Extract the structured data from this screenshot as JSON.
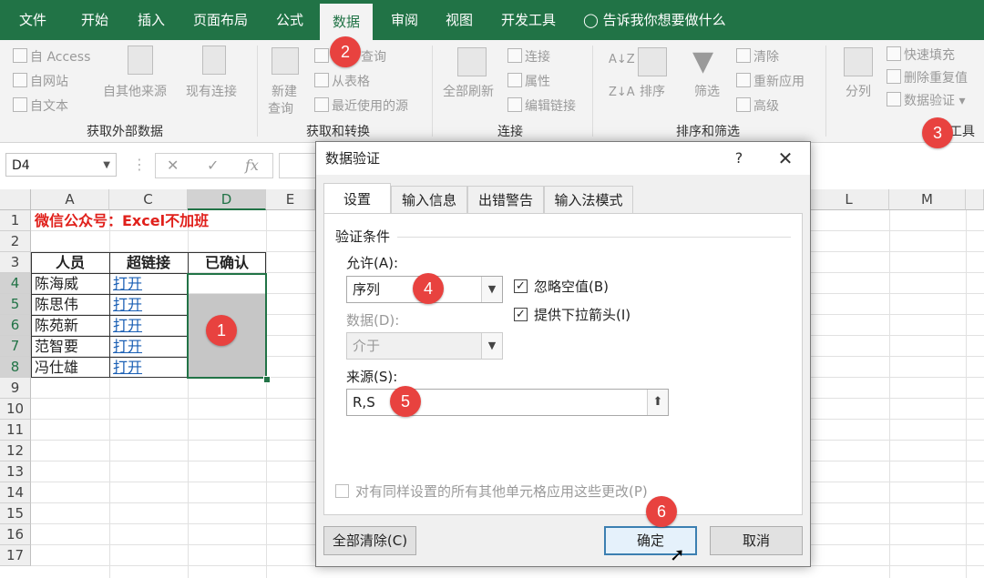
{
  "ribbon_tabs": [
    {
      "label": "文件"
    },
    {
      "label": "开始"
    },
    {
      "label": "插入"
    },
    {
      "label": "页面布局"
    },
    {
      "label": "公式"
    },
    {
      "label": "数据",
      "active": true
    },
    {
      "label": "审阅"
    },
    {
      "label": "视图"
    },
    {
      "label": "开发工具"
    }
  ],
  "tell_me": "告诉我你想要做什么",
  "ribbon": {
    "get_external": {
      "access": "自 Access",
      "web": "自网站",
      "text": "自文本",
      "other_sources": "自其他来源",
      "existing_connections": "现有连接",
      "group": "获取外部数据"
    },
    "get_transform": {
      "new_query": "新建",
      "new_query_sub": "查询",
      "show_queries": "查询",
      "from_table": "从表格",
      "recent_sources": "最近使用的源",
      "group": "获取和转换"
    },
    "connections": {
      "refresh_all": "全部刷新",
      "connections": "连接",
      "properties": "属性",
      "edit_links": "编辑链接",
      "group": "连接"
    },
    "sort_filter": {
      "sort": "排序",
      "filter": "筛选",
      "clear": "清除",
      "reapply": "重新应用",
      "advanced": "高级",
      "group": "排序和筛选"
    },
    "data_tools": {
      "text_to_columns": "分列",
      "flash_fill": "快速填充",
      "remove_duplicates": "删除重复值",
      "data_validation": "数据验证",
      "group_partial": "工具"
    }
  },
  "formula_bar": {
    "name_box": "D4",
    "fx": "fx"
  },
  "sheet": {
    "columns": [
      "A",
      "C",
      "D",
      "E",
      "L",
      "M"
    ],
    "rows": [
      "1",
      "2",
      "3",
      "4",
      "5",
      "6",
      "7",
      "8",
      "9",
      "10",
      "11",
      "12",
      "13",
      "14",
      "15",
      "16",
      "17"
    ],
    "banner": "微信公众号：Excel不加班",
    "headers": [
      "人员",
      "超链接",
      "已确认"
    ],
    "data": [
      {
        "name": "陈海威",
        "link": "打开"
      },
      {
        "name": "陈思伟",
        "link": "打开"
      },
      {
        "name": "陈苑新",
        "link": "打开"
      },
      {
        "name": "范智要",
        "link": "打开"
      },
      {
        "name": "冯仕雄",
        "link": "打开"
      }
    ]
  },
  "dialog": {
    "title": "数据验证",
    "help": "?",
    "tabs": [
      "设置",
      "输入信息",
      "出错警告",
      "输入法模式"
    ],
    "section": "验证条件",
    "allow_label": "允许(A):",
    "allow_value": "序列",
    "data_label": "数据(D):",
    "data_value": "介于",
    "ignore_blank": "忽略空值(B)",
    "in_cell_dropdown": "提供下拉箭头(I)",
    "source_label": "来源(S):",
    "source_value": "R,S",
    "apply_all": "对有同样设置的所有其他单元格应用这些更改(P)",
    "clear_all": "全部清除(C)",
    "ok": "确定",
    "cancel": "取消"
  },
  "steps": [
    "1",
    "2",
    "3",
    "4",
    "5",
    "6"
  ],
  "colors": {
    "excel_green": "#217346",
    "step_red": "#e8423f",
    "banner_red": "#e0201b",
    "link_blue": "#1a5fb4"
  }
}
